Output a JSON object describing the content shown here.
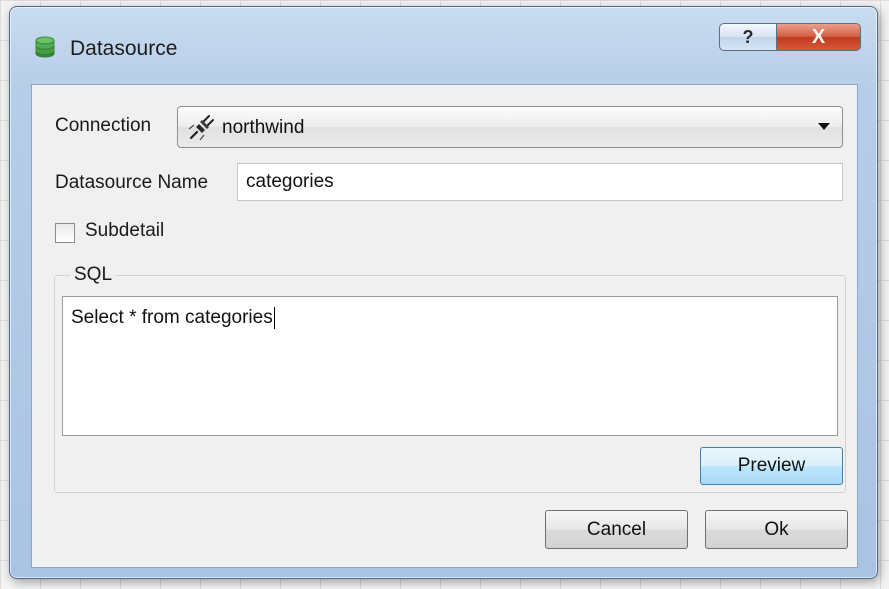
{
  "window": {
    "title": "Datasource",
    "help_glyph": "?",
    "close_glyph": "X",
    "icon": "database-icon"
  },
  "form": {
    "connection_label": "Connection",
    "connection_value": "northwind",
    "connection_icon": "plug-icon",
    "datasource_name_label": "Datasource Name",
    "datasource_name_value": "categories",
    "subdetail_label": "Subdetail",
    "subdetail_checked": false
  },
  "sql": {
    "group_title": "SQL",
    "query": "Select * from categories",
    "preview_label": "Preview"
  },
  "buttons": {
    "cancel_label": "Cancel",
    "ok_label": "Ok"
  },
  "colors": {
    "title_bar": "#b7cee8",
    "close_button": "#c23a1e",
    "db_icon_green": "#4caf50"
  }
}
